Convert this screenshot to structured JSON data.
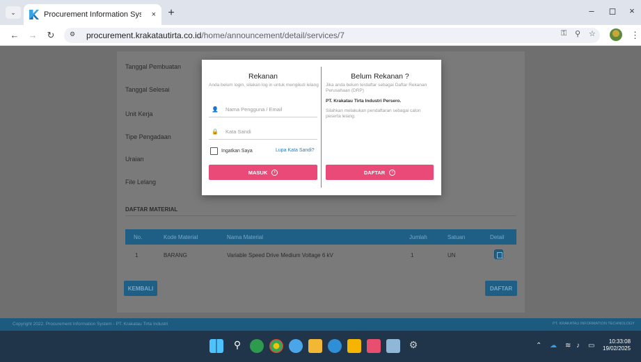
{
  "browser": {
    "tab_title": "Procurement Information Syste",
    "tab_close": "×",
    "new_tab": "+",
    "url_domain": "procurement.krakatautirta.co.id",
    "url_path": "/home/announcement/detail/services/7",
    "window_controls": {
      "minimize": "–",
      "maximize": "◻",
      "close": "×"
    }
  },
  "page": {
    "fields": [
      "Tanggal Pembuatan",
      "Tanggal Selesai",
      "Unit Kerja",
      "Tipe Pengadaan",
      "Uraian",
      "File Lelang"
    ],
    "section_title": "DAFTAR MATERIAL",
    "table": {
      "headers": [
        "No.",
        "Kode Material",
        "Nama Material",
        "Jumlah",
        "Satuan",
        "Detail"
      ],
      "rows": [
        {
          "no": "1",
          "kode": "BARANG",
          "nama": "Variable Speed Drive Medium Voltage 6 kV",
          "jumlah": "1",
          "satuan": "UN"
        }
      ]
    },
    "back_button": "KEMBALI",
    "register_button": "DAFTAR"
  },
  "footer": {
    "left": "Copyright 2022. Procurement Information System - PT. Krakatau Tirta Industri",
    "right": "PT. KRAKATAU INFORMATION TECHNOLOGY"
  },
  "modal": {
    "left_title": "Rekanan",
    "left_desc": "Anda belum login, silakan log in untuk mengikuti lelang",
    "username_placeholder": "Nama Pengguna / Email",
    "password_placeholder": "Kata Sandi",
    "remember_label": "Ingatkan Saya",
    "forgot_label": "Lupa Kata Sandi?",
    "login_button": "MASUK",
    "right_title": "Belum Rekanan ?",
    "right_desc": "Jika anda belum terdaftar sebagai Daftar Rekanan Perusahaan (DRP)",
    "company": "PT. Krakatau Tirta Industri Persero.",
    "right_desc2": "Silahkan melakukan pendaftaran sebagai calon peserta lelang.",
    "register_button": "DAFTAR"
  },
  "taskbar": {
    "time": "10:33:08",
    "date": "19/02/2025"
  }
}
